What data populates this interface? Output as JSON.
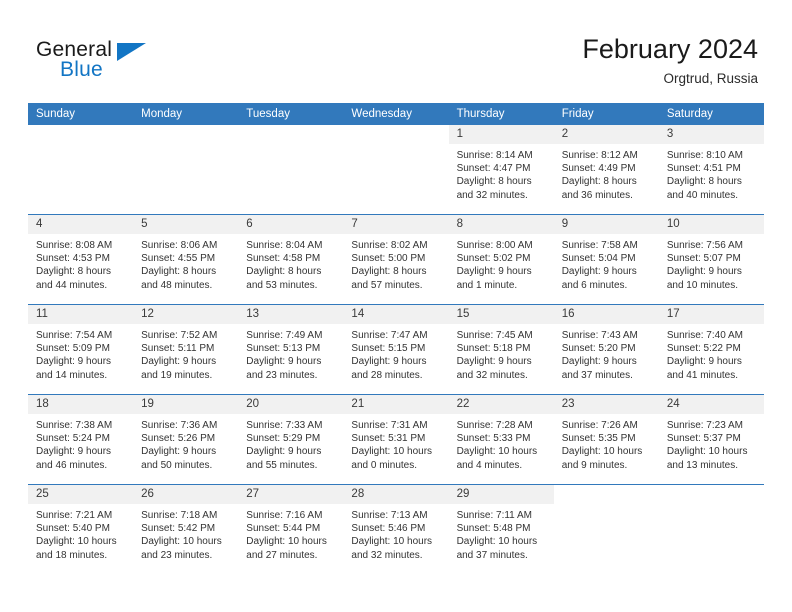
{
  "brand": {
    "name_part1": "General",
    "name_part2": "Blue",
    "flag_icon": "brand-flag-icon",
    "accent_color": "#1275c4"
  },
  "header": {
    "title": "February 2024",
    "subtitle": "Orgtrud, Russia"
  },
  "calendar": {
    "header_color": "#3279bc",
    "daynum_band_color": "#f1f1f1",
    "weekday_headers": [
      "Sunday",
      "Monday",
      "Tuesday",
      "Wednesday",
      "Thursday",
      "Friday",
      "Saturday"
    ],
    "weeks": [
      [
        {
          "day": "",
          "blank": true,
          "sunrise": "",
          "sunset": "",
          "daylight1": "",
          "daylight2": ""
        },
        {
          "day": "",
          "blank": true,
          "sunrise": "",
          "sunset": "",
          "daylight1": "",
          "daylight2": ""
        },
        {
          "day": "",
          "blank": true,
          "sunrise": "",
          "sunset": "",
          "daylight1": "",
          "daylight2": ""
        },
        {
          "day": "",
          "blank": true,
          "sunrise": "",
          "sunset": "",
          "daylight1": "",
          "daylight2": ""
        },
        {
          "day": "1",
          "sunrise": "Sunrise: 8:14 AM",
          "sunset": "Sunset: 4:47 PM",
          "daylight1": "Daylight: 8 hours",
          "daylight2": "and 32 minutes."
        },
        {
          "day": "2",
          "sunrise": "Sunrise: 8:12 AM",
          "sunset": "Sunset: 4:49 PM",
          "daylight1": "Daylight: 8 hours",
          "daylight2": "and 36 minutes."
        },
        {
          "day": "3",
          "sunrise": "Sunrise: 8:10 AM",
          "sunset": "Sunset: 4:51 PM",
          "daylight1": "Daylight: 8 hours",
          "daylight2": "and 40 minutes."
        }
      ],
      [
        {
          "day": "4",
          "sunrise": "Sunrise: 8:08 AM",
          "sunset": "Sunset: 4:53 PM",
          "daylight1": "Daylight: 8 hours",
          "daylight2": "and 44 minutes."
        },
        {
          "day": "5",
          "sunrise": "Sunrise: 8:06 AM",
          "sunset": "Sunset: 4:55 PM",
          "daylight1": "Daylight: 8 hours",
          "daylight2": "and 48 minutes."
        },
        {
          "day": "6",
          "sunrise": "Sunrise: 8:04 AM",
          "sunset": "Sunset: 4:58 PM",
          "daylight1": "Daylight: 8 hours",
          "daylight2": "and 53 minutes."
        },
        {
          "day": "7",
          "sunrise": "Sunrise: 8:02 AM",
          "sunset": "Sunset: 5:00 PM",
          "daylight1": "Daylight: 8 hours",
          "daylight2": "and 57 minutes."
        },
        {
          "day": "8",
          "sunrise": "Sunrise: 8:00 AM",
          "sunset": "Sunset: 5:02 PM",
          "daylight1": "Daylight: 9 hours",
          "daylight2": "and 1 minute."
        },
        {
          "day": "9",
          "sunrise": "Sunrise: 7:58 AM",
          "sunset": "Sunset: 5:04 PM",
          "daylight1": "Daylight: 9 hours",
          "daylight2": "and 6 minutes."
        },
        {
          "day": "10",
          "sunrise": "Sunrise: 7:56 AM",
          "sunset": "Sunset: 5:07 PM",
          "daylight1": "Daylight: 9 hours",
          "daylight2": "and 10 minutes."
        }
      ],
      [
        {
          "day": "11",
          "sunrise": "Sunrise: 7:54 AM",
          "sunset": "Sunset: 5:09 PM",
          "daylight1": "Daylight: 9 hours",
          "daylight2": "and 14 minutes."
        },
        {
          "day": "12",
          "sunrise": "Sunrise: 7:52 AM",
          "sunset": "Sunset: 5:11 PM",
          "daylight1": "Daylight: 9 hours",
          "daylight2": "and 19 minutes."
        },
        {
          "day": "13",
          "sunrise": "Sunrise: 7:49 AM",
          "sunset": "Sunset: 5:13 PM",
          "daylight1": "Daylight: 9 hours",
          "daylight2": "and 23 minutes."
        },
        {
          "day": "14",
          "sunrise": "Sunrise: 7:47 AM",
          "sunset": "Sunset: 5:15 PM",
          "daylight1": "Daylight: 9 hours",
          "daylight2": "and 28 minutes."
        },
        {
          "day": "15",
          "sunrise": "Sunrise: 7:45 AM",
          "sunset": "Sunset: 5:18 PM",
          "daylight1": "Daylight: 9 hours",
          "daylight2": "and 32 minutes."
        },
        {
          "day": "16",
          "sunrise": "Sunrise: 7:43 AM",
          "sunset": "Sunset: 5:20 PM",
          "daylight1": "Daylight: 9 hours",
          "daylight2": "and 37 minutes."
        },
        {
          "day": "17",
          "sunrise": "Sunrise: 7:40 AM",
          "sunset": "Sunset: 5:22 PM",
          "daylight1": "Daylight: 9 hours",
          "daylight2": "and 41 minutes."
        }
      ],
      [
        {
          "day": "18",
          "sunrise": "Sunrise: 7:38 AM",
          "sunset": "Sunset: 5:24 PM",
          "daylight1": "Daylight: 9 hours",
          "daylight2": "and 46 minutes."
        },
        {
          "day": "19",
          "sunrise": "Sunrise: 7:36 AM",
          "sunset": "Sunset: 5:26 PM",
          "daylight1": "Daylight: 9 hours",
          "daylight2": "and 50 minutes."
        },
        {
          "day": "20",
          "sunrise": "Sunrise: 7:33 AM",
          "sunset": "Sunset: 5:29 PM",
          "daylight1": "Daylight: 9 hours",
          "daylight2": "and 55 minutes."
        },
        {
          "day": "21",
          "sunrise": "Sunrise: 7:31 AM",
          "sunset": "Sunset: 5:31 PM",
          "daylight1": "Daylight: 10 hours",
          "daylight2": "and 0 minutes."
        },
        {
          "day": "22",
          "sunrise": "Sunrise: 7:28 AM",
          "sunset": "Sunset: 5:33 PM",
          "daylight1": "Daylight: 10 hours",
          "daylight2": "and 4 minutes."
        },
        {
          "day": "23",
          "sunrise": "Sunrise: 7:26 AM",
          "sunset": "Sunset: 5:35 PM",
          "daylight1": "Daylight: 10 hours",
          "daylight2": "and 9 minutes."
        },
        {
          "day": "24",
          "sunrise": "Sunrise: 7:23 AM",
          "sunset": "Sunset: 5:37 PM",
          "daylight1": "Daylight: 10 hours",
          "daylight2": "and 13 minutes."
        }
      ],
      [
        {
          "day": "25",
          "sunrise": "Sunrise: 7:21 AM",
          "sunset": "Sunset: 5:40 PM",
          "daylight1": "Daylight: 10 hours",
          "daylight2": "and 18 minutes."
        },
        {
          "day": "26",
          "sunrise": "Sunrise: 7:18 AM",
          "sunset": "Sunset: 5:42 PM",
          "daylight1": "Daylight: 10 hours",
          "daylight2": "and 23 minutes."
        },
        {
          "day": "27",
          "sunrise": "Sunrise: 7:16 AM",
          "sunset": "Sunset: 5:44 PM",
          "daylight1": "Daylight: 10 hours",
          "daylight2": "and 27 minutes."
        },
        {
          "day": "28",
          "sunrise": "Sunrise: 7:13 AM",
          "sunset": "Sunset: 5:46 PM",
          "daylight1": "Daylight: 10 hours",
          "daylight2": "and 32 minutes."
        },
        {
          "day": "29",
          "sunrise": "Sunrise: 7:11 AM",
          "sunset": "Sunset: 5:48 PM",
          "daylight1": "Daylight: 10 hours",
          "daylight2": "and 37 minutes."
        },
        {
          "day": "",
          "blank": true,
          "sunrise": "",
          "sunset": "",
          "daylight1": "",
          "daylight2": ""
        },
        {
          "day": "",
          "blank": true,
          "sunrise": "",
          "sunset": "",
          "daylight1": "",
          "daylight2": ""
        }
      ]
    ]
  }
}
